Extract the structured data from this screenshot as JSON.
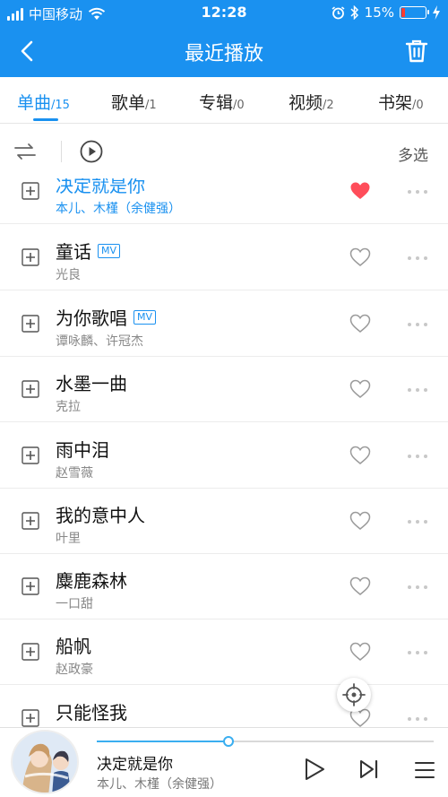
{
  "status_bar": {
    "carrier": "中国移动",
    "time": "12:28",
    "battery": "15%",
    "battery_level": 0.15,
    "icons": [
      "signal-icon",
      "wifi-icon",
      "alarm-icon",
      "bluetooth-icon",
      "battery-icon",
      "charging-icon"
    ]
  },
  "header": {
    "title": "最近播放",
    "back_icon": "back-arrow-icon",
    "trash_icon": "trash-icon"
  },
  "tabs": [
    {
      "label": "单曲",
      "count": "/15",
      "active": true
    },
    {
      "label": "歌单",
      "count": "/1",
      "active": false
    },
    {
      "label": "专辑",
      "count": "/0",
      "active": false
    },
    {
      "label": "视频",
      "count": "/2",
      "active": false
    },
    {
      "label": "书架",
      "count": "/0",
      "active": false
    }
  ],
  "toolbar": {
    "multi_select": "多选",
    "shuffle_icon": "shuffle-icon",
    "play_all_icon": "play-circle-icon"
  },
  "songs": [
    {
      "title": "决定就是你",
      "artist": "本儿、木槿（余健强）",
      "mv": false,
      "liked": true,
      "playing": true
    },
    {
      "title": "童话",
      "artist": "光良",
      "mv": true,
      "liked": false,
      "playing": false
    },
    {
      "title": "为你歌唱",
      "artist": "谭咏麟、许冠杰",
      "mv": true,
      "liked": false,
      "playing": false
    },
    {
      "title": "水墨一曲",
      "artist": "克拉",
      "mv": false,
      "liked": false,
      "playing": false
    },
    {
      "title": "雨中泪",
      "artist": "赵雪薇",
      "mv": false,
      "liked": false,
      "playing": false
    },
    {
      "title": "我的意中人",
      "artist": "叶里",
      "mv": false,
      "liked": false,
      "playing": false
    },
    {
      "title": "麋鹿森林",
      "artist": "一口甜",
      "mv": false,
      "liked": false,
      "playing": false
    },
    {
      "title": "船帆",
      "artist": "赵政豪",
      "mv": false,
      "liked": false,
      "playing": false
    },
    {
      "title": "只能怪我",
      "artist": "",
      "mv": false,
      "liked": false,
      "playing": false
    }
  ],
  "mv_badge": "MV",
  "now_playing": {
    "title": "决定就是你",
    "artist": "本儿、木槿（余健强）",
    "progress": 0.39
  },
  "colors": {
    "primary": "#1a91f0",
    "liked_heart": "#ff4d5a",
    "battery_low": "#ff3b30"
  }
}
